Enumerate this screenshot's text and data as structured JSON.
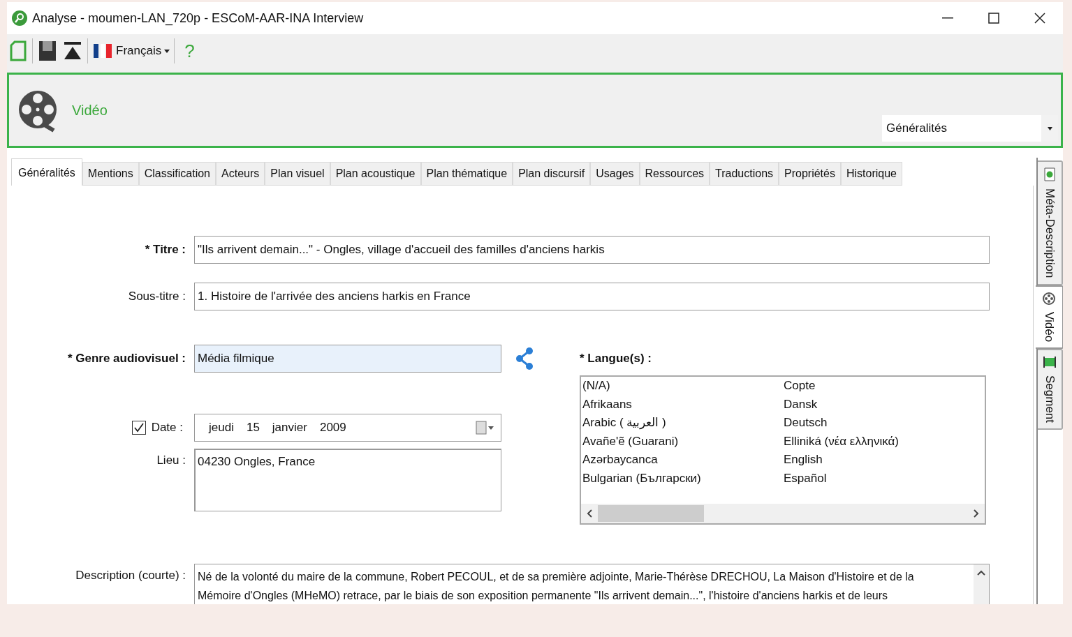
{
  "window": {
    "title": "Analyse - moumen-LAN_720p - ESCoM-AAR-INA Interview"
  },
  "toolbar": {
    "language": "Français",
    "help": "?"
  },
  "header": {
    "title": "Vidéo",
    "view_select": "Généralités"
  },
  "tabs": [
    {
      "label": "Généralités",
      "selected": true
    },
    {
      "label": "Mentions",
      "selected": false
    },
    {
      "label": "Classification",
      "selected": false
    },
    {
      "label": "Acteurs",
      "selected": false
    },
    {
      "label": "Plan visuel",
      "selected": false
    },
    {
      "label": "Plan acoustique",
      "selected": false
    },
    {
      "label": "Plan thématique",
      "selected": false
    },
    {
      "label": "Plan discursif",
      "selected": false
    },
    {
      "label": "Usages",
      "selected": false
    },
    {
      "label": "Ressources",
      "selected": false
    },
    {
      "label": "Traductions",
      "selected": false
    },
    {
      "label": "Propriétés",
      "selected": false
    },
    {
      "label": "Historique",
      "selected": false
    }
  ],
  "side_tabs": [
    {
      "label": "Méta-Description",
      "kind": "meta",
      "selected": false
    },
    {
      "label": "Vidéo",
      "kind": "video",
      "selected": true
    },
    {
      "label": "Segment",
      "kind": "segment",
      "selected": false
    }
  ],
  "form": {
    "title_label": "* Titre :",
    "title_value": "\"Ils arrivent demain...\" - Ongles, village d'accueil des familles d'anciens harkis",
    "subtitle_label": "Sous-titre :",
    "subtitle_value": "1. Histoire de l'arrivée des anciens harkis en France",
    "genre_label": "* Genre audiovisuel :",
    "genre_value": "Média filmique",
    "date_label": "Date :",
    "date_checked": true,
    "date_parts": [
      "jeudi",
      "15",
      "janvier",
      "2009"
    ],
    "place_label": "Lieu :",
    "place_value": "04230 Ongles, France",
    "languages_label": "* Langue(s) :",
    "languages": [
      "(N/A)",
      "Afrikaans",
      "Arabic ( العربية )",
      "Avañe'ẽ (Guarani)",
      "Azərbaycanca",
      "Bulgarian (Български)",
      "Copte",
      "Dansk",
      "Deutsch",
      "Elliniká (νέα ελληνικά)",
      "English",
      "Español"
    ],
    "description_label": "Description (courte) :",
    "description_lines": [
      "Né de la volonté du maire de la commune, Robert PECOUL, et de sa première adjointe, Marie-Thérèse DRECHOU, La Maison d'Histoire et de la",
      "Mémoire d'Ongles (MHeMO) retrace, par le biais de son exposition permanente \"Ils arrivent demain...\", l'histoire d'anciens harkis et de leurs"
    ]
  }
}
